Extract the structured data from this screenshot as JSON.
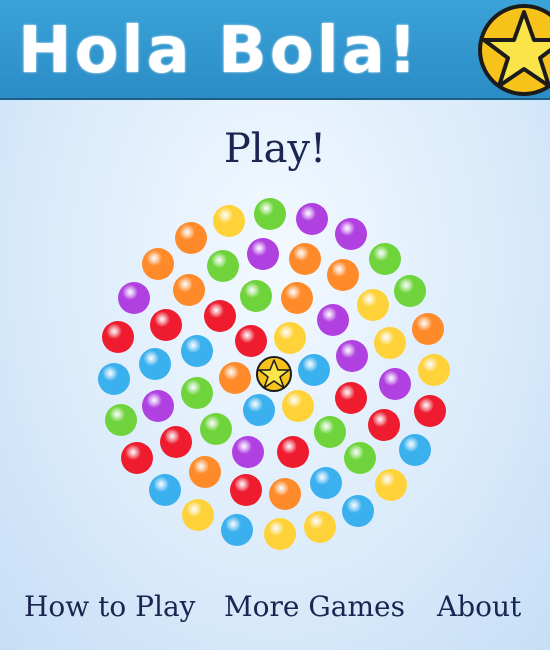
{
  "header": {
    "logo_text": "Hola Bola!",
    "background": "#2f96cf"
  },
  "menu": {
    "play_label": "Play!",
    "how_to_play_label": "How to Play",
    "more_games_label": "More Games",
    "about_label": "About"
  },
  "center_icon": "star-icon",
  "colors": {
    "yellow": "#ffd23a",
    "green": "#6fd43c",
    "purple": "#b040e0",
    "orange": "#ff8a2a",
    "red": "#ee1c2e",
    "blue": "#3bb0ee"
  },
  "balls": [
    {
      "color": "yellow",
      "name": "ball-yellow"
    },
    {
      "color": "green",
      "name": "ball-green"
    },
    {
      "color": "purple",
      "name": "ball-purple"
    },
    {
      "color": "purple",
      "name": "ball-purple"
    },
    {
      "color": "orange",
      "name": "ball-orange"
    },
    {
      "color": "purple",
      "name": "ball-purple"
    },
    {
      "color": "orange",
      "name": "ball-orange"
    },
    {
      "color": "green",
      "name": "ball-green"
    },
    {
      "color": "orange",
      "name": "ball-orange"
    },
    {
      "color": "green",
      "name": "ball-green"
    },
    {
      "color": "orange",
      "name": "ball-orange"
    },
    {
      "color": "green",
      "name": "ball-green"
    },
    {
      "color": "purple",
      "name": "ball-purple"
    },
    {
      "color": "orange",
      "name": "ball-orange"
    },
    {
      "color": "green",
      "name": "ball-green"
    },
    {
      "color": "orange",
      "name": "ball-orange"
    },
    {
      "color": "yellow",
      "name": "ball-yellow"
    },
    {
      "color": "red",
      "name": "ball-red"
    },
    {
      "color": "red",
      "name": "ball-red"
    },
    {
      "color": "red",
      "name": "ball-red"
    },
    {
      "color": "orange",
      "name": "ball-orange"
    },
    {
      "color": "blue",
      "name": "ball-blue"
    },
    {
      "color": "red",
      "name": "ball-red"
    },
    {
      "color": "yellow",
      "name": "ball-yellow"
    },
    {
      "color": "purple",
      "name": "ball-purple"
    },
    {
      "color": "yellow",
      "name": "ball-yellow"
    },
    {
      "color": "green",
      "name": "ball-green"
    },
    {
      "color": "blue",
      "name": "ball-blue"
    },
    {
      "color": "purple",
      "name": "ball-purple"
    },
    {
      "color": "yellow",
      "name": "ball-yellow"
    },
    {
      "color": "blue",
      "name": "ball-blue"
    },
    {
      "color": "orange",
      "name": "ball-orange"
    },
    {
      "color": "blue",
      "name": "ball-blue"
    },
    {
      "color": "purple",
      "name": "ball-purple"
    },
    {
      "color": "red",
      "name": "ball-red"
    },
    {
      "color": "purple",
      "name": "ball-purple"
    },
    {
      "color": "green",
      "name": "ball-green"
    },
    {
      "color": "red",
      "name": "ball-red"
    },
    {
      "color": "orange",
      "name": "ball-orange"
    },
    {
      "color": "blue",
      "name": "ball-blue"
    },
    {
      "color": "yellow",
      "name": "ball-yellow"
    },
    {
      "color": "red",
      "name": "ball-red"
    },
    {
      "color": "green",
      "name": "ball-green"
    },
    {
      "color": "red",
      "name": "ball-red"
    },
    {
      "color": "red",
      "name": "ball-red"
    },
    {
      "color": "purple",
      "name": "ball-purple"
    },
    {
      "color": "red",
      "name": "ball-red"
    },
    {
      "color": "green",
      "name": "ball-green"
    },
    {
      "color": "blue",
      "name": "ball-blue"
    },
    {
      "color": "green",
      "name": "ball-green"
    },
    {
      "color": "red",
      "name": "ball-red"
    },
    {
      "color": "orange",
      "name": "ball-orange"
    },
    {
      "color": "blue",
      "name": "ball-blue"
    },
    {
      "color": "yellow",
      "name": "ball-yellow"
    },
    {
      "color": "blue",
      "name": "ball-blue"
    },
    {
      "color": "yellow",
      "name": "ball-yellow"
    },
    {
      "color": "blue",
      "name": "ball-blue"
    },
    {
      "color": "yellow",
      "name": "ball-yellow"
    },
    {
      "color": "yellow",
      "name": "ball-yellow"
    },
    {
      "color": "blue",
      "name": "ball-blue"
    }
  ]
}
